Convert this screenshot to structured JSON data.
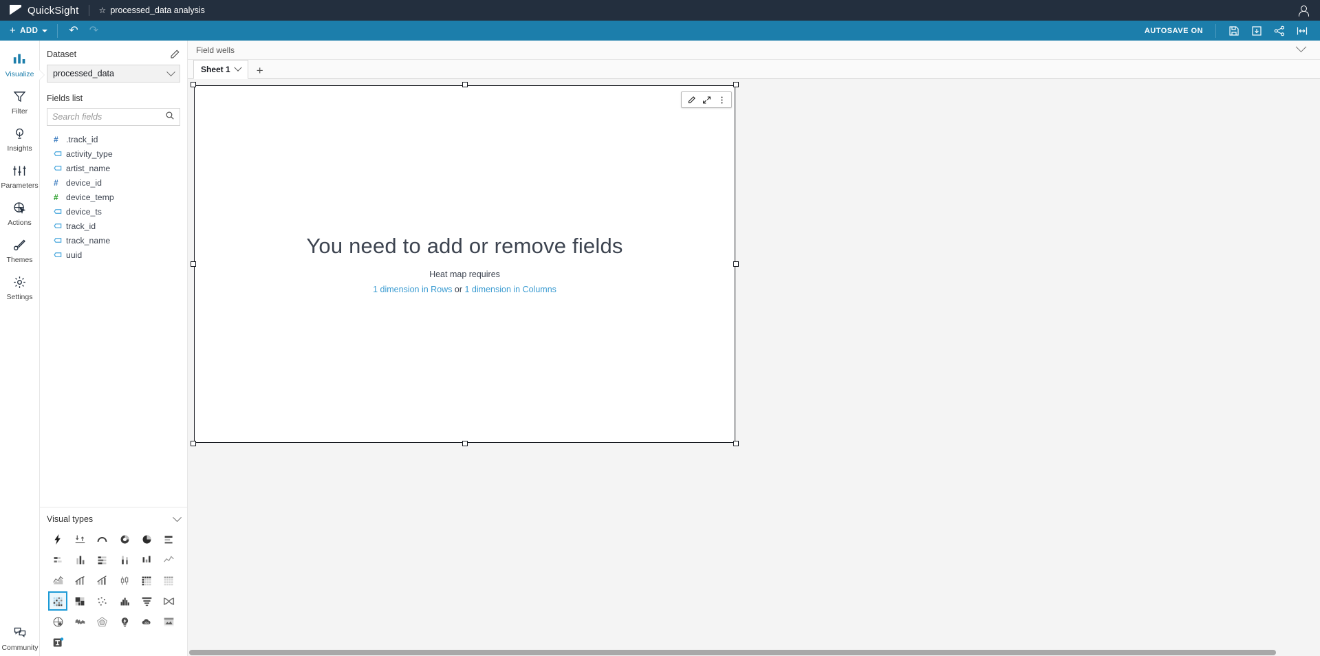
{
  "topbar": {
    "product_name": "QuickSight",
    "analysis_title": "processed_data analysis",
    "star_icon": "star-icon",
    "user_icon": "user-account-icon"
  },
  "toolbar": {
    "add_label": "ADD",
    "undo_icon": "undo-icon",
    "redo_icon": "redo-icon",
    "undo_glyph": "↶",
    "redo_glyph": "↷",
    "autosave_label": "AUTOSAVE ON",
    "icons": [
      "save-icon",
      "export-download-icon",
      "share-icon",
      "fit-width-icon"
    ]
  },
  "leftnav": {
    "items": [
      {
        "label": "Visualize",
        "icon": "bar-chart-icon",
        "active": true
      },
      {
        "label": "Filter",
        "icon": "funnel-icon",
        "active": false
      },
      {
        "label": "Insights",
        "icon": "lightbulb-icon",
        "active": false
      },
      {
        "label": "Parameters",
        "icon": "sliders-icon",
        "active": false
      },
      {
        "label": "Actions",
        "icon": "target-cursor-icon",
        "active": false
      },
      {
        "label": "Themes",
        "icon": "paintbrush-icon",
        "active": false
      },
      {
        "label": "Settings",
        "icon": "gear-icon",
        "active": false
      }
    ],
    "community": {
      "label": "Community",
      "icon": "chat-bubbles-icon"
    }
  },
  "panel": {
    "dataset_header": "Dataset",
    "dataset_edit_icon": "pencil-icon",
    "dataset_value": "processed_data",
    "fields_header": "Fields list",
    "search_placeholder": "Search fields",
    "search_value": "",
    "search_icon": "search-icon",
    "fields": [
      {
        "name": ".track_id",
        "type": "number"
      },
      {
        "name": "activity_type",
        "type": "string"
      },
      {
        "name": "artist_name",
        "type": "string"
      },
      {
        "name": "device_id",
        "type": "number"
      },
      {
        "name": "device_temp",
        "type": "number-green"
      },
      {
        "name": "device_ts",
        "type": "string"
      },
      {
        "name": "track_id",
        "type": "string"
      },
      {
        "name": "track_name",
        "type": "string"
      },
      {
        "name": "uuid",
        "type": "string"
      }
    ]
  },
  "visual_types": {
    "header": "Visual types",
    "collapse_icon": "chevron-down-icon",
    "items": [
      {
        "name": "autograph",
        "selected": false
      },
      {
        "name": "kpi",
        "selected": false
      },
      {
        "name": "gauge-chart",
        "selected": false
      },
      {
        "name": "donut-chart",
        "selected": false
      },
      {
        "name": "pie-chart",
        "selected": false
      },
      {
        "name": "horizontal-bar-chart",
        "selected": false
      },
      {
        "name": "horizontal-stacked-bar-chart",
        "selected": false
      },
      {
        "name": "vertical-bar-chart",
        "selected": false
      },
      {
        "name": "horizontal-stacked-100-bar",
        "selected": false
      },
      {
        "name": "vertical-stacked-bar-chart",
        "selected": false
      },
      {
        "name": "waterfall-chart",
        "selected": false
      },
      {
        "name": "line-chart",
        "selected": false
      },
      {
        "name": "area-line-chart",
        "selected": false
      },
      {
        "name": "combo-bar-line-chart",
        "selected": false
      },
      {
        "name": "stacked-combo-chart",
        "selected": false
      },
      {
        "name": "box-plot",
        "selected": false
      },
      {
        "name": "table",
        "selected": false
      },
      {
        "name": "pivot-table",
        "selected": false
      },
      {
        "name": "heat-map",
        "selected": true
      },
      {
        "name": "treemap",
        "selected": false
      },
      {
        "name": "scatter-plot",
        "selected": false
      },
      {
        "name": "histogram",
        "selected": false
      },
      {
        "name": "funnel-chart",
        "selected": false
      },
      {
        "name": "sankey-diagram",
        "selected": false
      },
      {
        "name": "geospatial-map",
        "selected": false
      },
      {
        "name": "filled-map",
        "selected": false
      },
      {
        "name": "radar-chart",
        "selected": false
      },
      {
        "name": "insight",
        "selected": false
      },
      {
        "name": "word-cloud",
        "selected": false
      },
      {
        "name": "custom-visual-content",
        "selected": false
      },
      {
        "name": "text-box",
        "selected": false
      }
    ]
  },
  "content": {
    "fieldwells_label": "Field wells",
    "fieldwells_collapse_icon": "chevron-down-icon",
    "sheet_tab_label": "Sheet 1",
    "sheet_tab_chevron": "chevron-down-icon",
    "add_sheet_label": "+"
  },
  "visual": {
    "toolbar_icons": [
      "edit-pencil-icon",
      "expand-icon",
      "more-options-icon"
    ],
    "empty_title": "You need to add or remove fields",
    "empty_subtitle": "Heat map requires",
    "requirement_link_1": "1 dimension in Rows",
    "requirement_or": " or ",
    "requirement_link_2": "1 dimension in Columns"
  },
  "colors": {
    "topbar_bg": "#232f3e",
    "toolbar_bg": "#1c7eab",
    "accent_blue": "#1c9ad6",
    "link_blue": "#3a9bd1",
    "canvas_bg": "#f4f4f4",
    "number_field": "#3a7bbf",
    "number_field_green": "#2ca02c",
    "string_field": "#4aa8dd"
  }
}
